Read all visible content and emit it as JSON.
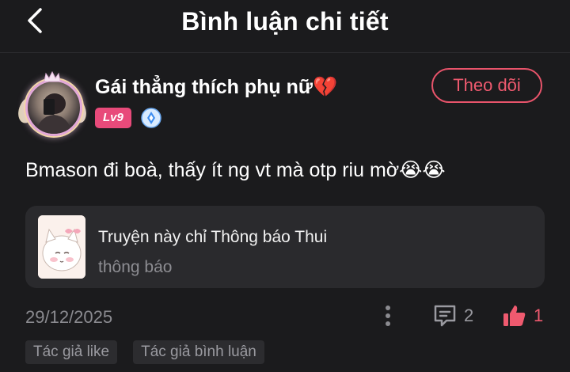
{
  "header": {
    "title": "Bình luận chi tiết"
  },
  "comment": {
    "author": "Gái thẳng thích phụ nữ💔",
    "level": "Lv9",
    "follow_label": "Theo dõi",
    "text": "Bmason đi boà, thấy ít ng vt mà otp riu mờ😭😭",
    "quote": {
      "title": "Truyện này chỉ Thông báo Thui",
      "subtitle": "thông báo"
    },
    "date": "29/12/2025",
    "reply_count": "2",
    "like_count": "1",
    "tags": [
      "Tác giả like",
      "Tác giả bình luận"
    ]
  },
  "colors": {
    "background": "#1b1b1d",
    "accent": "#ef5a6f",
    "level_badge": "#e84a7a",
    "card": "#2a2a2d"
  },
  "icons": [
    "back-arrow-icon",
    "vip-diamond-icon",
    "more-vertical-icon",
    "comment-icon",
    "thumbs-up-icon"
  ]
}
